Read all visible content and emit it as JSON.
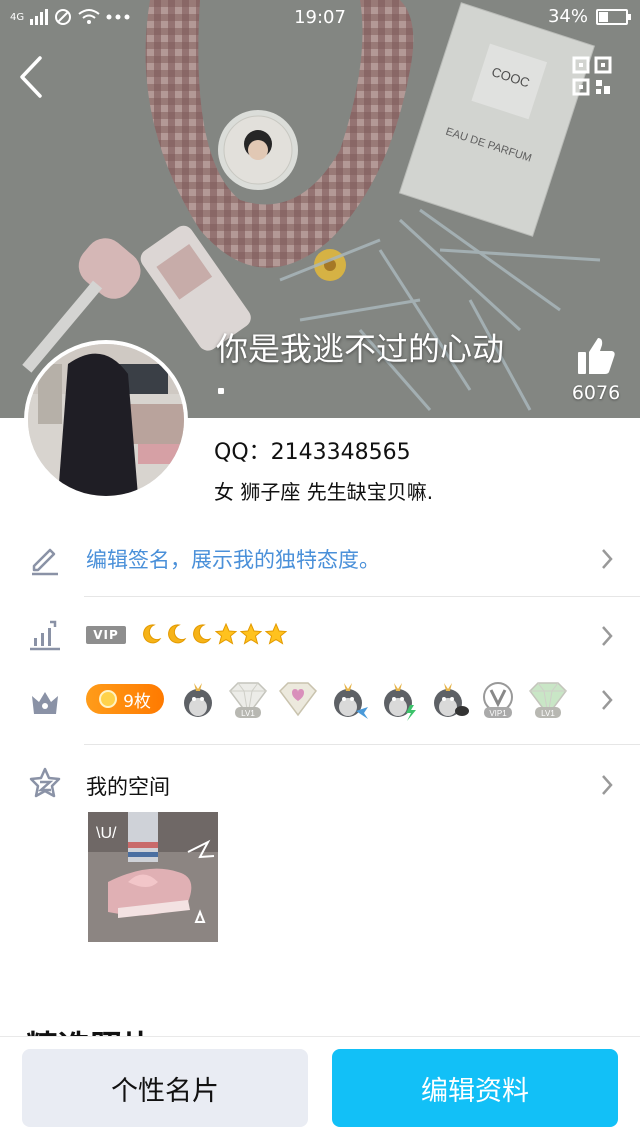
{
  "status_bar": {
    "network": "4G",
    "time": "19:07",
    "battery": "34%",
    "battery_level": 0.34
  },
  "cover": {
    "signature": "你是我逃不过的心动",
    "likes": "6076"
  },
  "profile": {
    "qq": "QQ：2143348565",
    "info": "女  狮子座  先生缺宝贝嘛."
  },
  "rows": {
    "edit_signature": "编辑签名，展示我的独特态度。",
    "vip_badge": "VIP",
    "level_icons": [
      "moon",
      "moon",
      "moon",
      "star",
      "star",
      "star"
    ],
    "medal_count": "9枚",
    "medals": [
      {
        "name": "penguin-crown-medal",
        "label": ""
      },
      {
        "name": "diamond-lv1-medal",
        "label": "LV1"
      },
      {
        "name": "heart-diamond-medal",
        "label": ""
      },
      {
        "name": "penguin-fish-medal",
        "label": ""
      },
      {
        "name": "penguin-bolt-medal",
        "label": ""
      },
      {
        "name": "penguin-bird-medal",
        "label": ""
      },
      {
        "name": "vip1-medal",
        "label": "VIP1"
      },
      {
        "name": "green-diamond-lv1-medal",
        "label": "LV1"
      }
    ],
    "my_space": "我的空间"
  },
  "section_heading_partial": "精选照片",
  "bottom": {
    "card_button": "个性名片",
    "edit_button": "编辑资料"
  },
  "colors": {
    "accent_blue": "#12c0f7",
    "link_blue": "#4a90d9",
    "medal_orange": "#ff8a00"
  }
}
